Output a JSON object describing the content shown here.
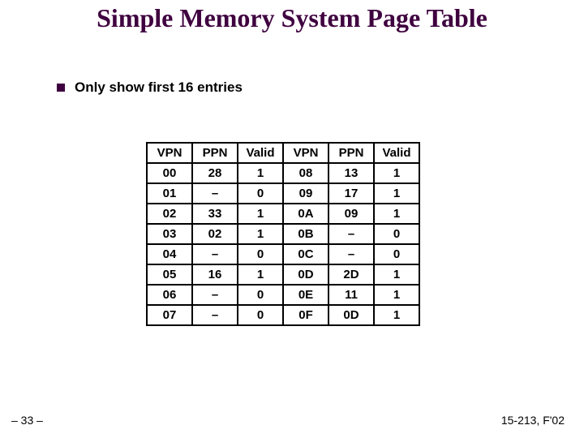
{
  "title": "Simple Memory System Page Table",
  "bullet": "Only show first 16 entries",
  "headers": [
    "VPN",
    "PPN",
    "Valid",
    "VPN",
    "PPN",
    "Valid"
  ],
  "rows": [
    [
      "00",
      "28",
      "1",
      "08",
      "13",
      "1"
    ],
    [
      "01",
      "–",
      "0",
      "09",
      "17",
      "1"
    ],
    [
      "02",
      "33",
      "1",
      "0A",
      "09",
      "1"
    ],
    [
      "03",
      "02",
      "1",
      "0B",
      "–",
      "0"
    ],
    [
      "04",
      "–",
      "0",
      "0C",
      "–",
      "0"
    ],
    [
      "05",
      "16",
      "1",
      "0D",
      "2D",
      "1"
    ],
    [
      "06",
      "–",
      "0",
      "0E",
      "11",
      "1"
    ],
    [
      "07",
      "–",
      "0",
      "0F",
      "0D",
      "1"
    ]
  ],
  "footer": {
    "left": "– 33 –",
    "right": "15-213, F'02"
  },
  "chart_data": {
    "type": "table",
    "title": "Simple Memory System Page Table",
    "columns": [
      "VPN",
      "PPN",
      "Valid"
    ],
    "rows": [
      {
        "VPN": "00",
        "PPN": "28",
        "Valid": 1
      },
      {
        "VPN": "01",
        "PPN": null,
        "Valid": 0
      },
      {
        "VPN": "02",
        "PPN": "33",
        "Valid": 1
      },
      {
        "VPN": "03",
        "PPN": "02",
        "Valid": 1
      },
      {
        "VPN": "04",
        "PPN": null,
        "Valid": 0
      },
      {
        "VPN": "05",
        "PPN": "16",
        "Valid": 1
      },
      {
        "VPN": "06",
        "PPN": null,
        "Valid": 0
      },
      {
        "VPN": "07",
        "PPN": null,
        "Valid": 0
      },
      {
        "VPN": "08",
        "PPN": "13",
        "Valid": 1
      },
      {
        "VPN": "09",
        "PPN": "17",
        "Valid": 1
      },
      {
        "VPN": "0A",
        "PPN": "09",
        "Valid": 1
      },
      {
        "VPN": "0B",
        "PPN": null,
        "Valid": 0
      },
      {
        "VPN": "0C",
        "PPN": null,
        "Valid": 0
      },
      {
        "VPN": "0D",
        "PPN": "2D",
        "Valid": 1
      },
      {
        "VPN": "0E",
        "PPN": "11",
        "Valid": 1
      },
      {
        "VPN": "0F",
        "PPN": "0D",
        "Valid": 1
      }
    ]
  }
}
